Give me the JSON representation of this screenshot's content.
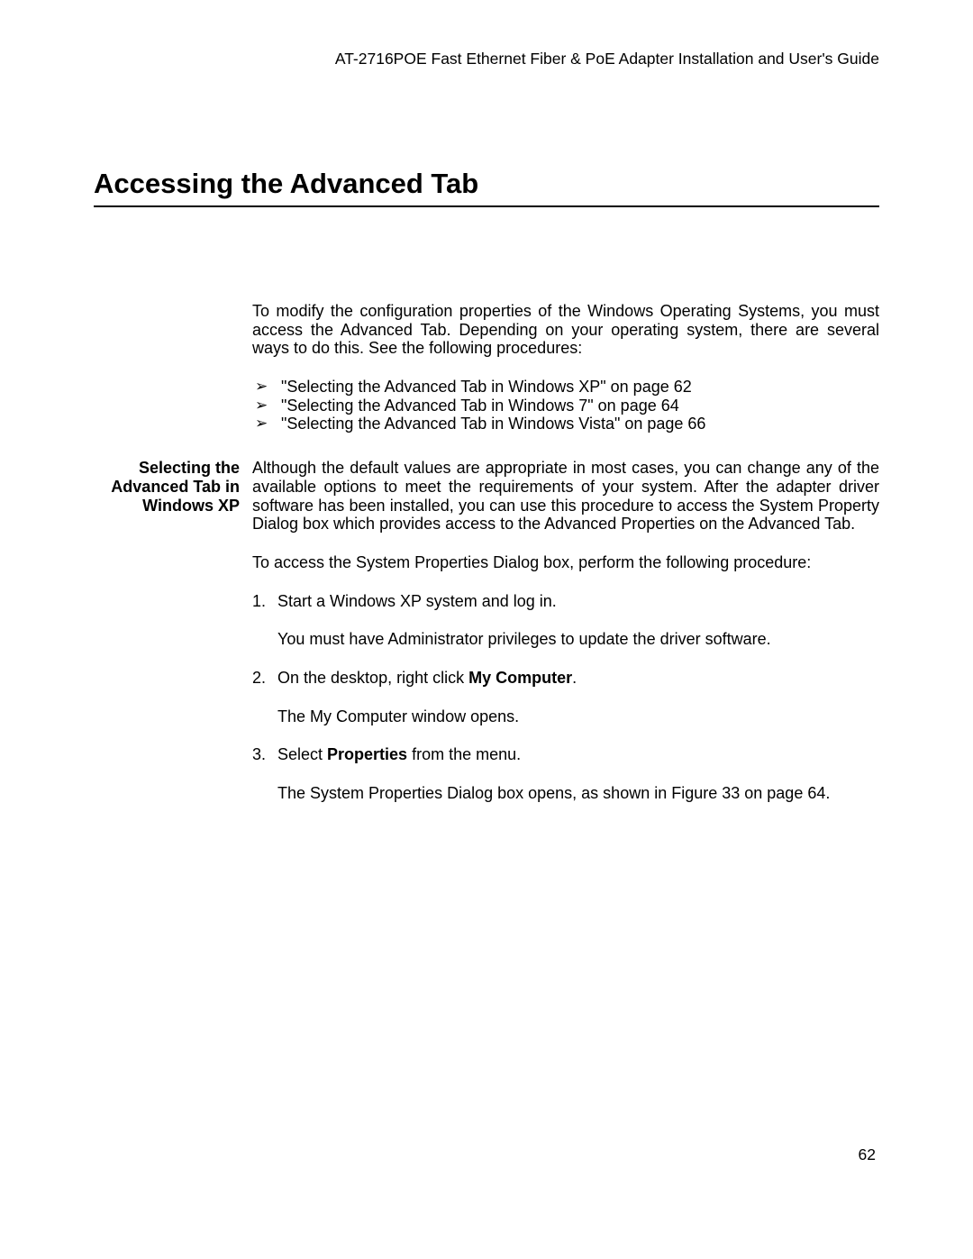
{
  "header": "AT-2716POE Fast Ethernet Fiber & PoE Adapter Installation and User's Guide",
  "title": "Accessing the Advanced Tab",
  "intro": "To modify the configuration properties of the Windows Operating Systems, you must access the Advanced Tab. Depending on your operating system, there are several ways to do this. See the following procedures:",
  "bullets": [
    "\"Selecting the Advanced Tab in Windows XP\" on page 62",
    "\"Selecting the Advanced Tab in Windows 7\" on page 64",
    "\"Selecting the Advanced Tab in Windows Vista\" on page 66"
  ],
  "section_label": "Selecting the Advanced Tab in Windows XP",
  "para1": "Although the default values are appropriate in most cases, you can change any of the available options to meet the requirements of your system. After the adapter driver software has been installed, you can use this procedure to access the System Property Dialog box which provides access to the Advanced Properties on the Advanced Tab.",
  "para2": "To access the System Properties Dialog box, perform the following procedure:",
  "steps": {
    "s1_num": "1.",
    "s1_text": "Start a Windows XP system and log in.",
    "s1_sub": "You must have Administrator privileges to update the driver software.",
    "s2_num": "2.",
    "s2_text_a": "On the desktop, right click ",
    "s2_bold": "My Computer",
    "s2_text_b": ".",
    "s2_sub": "The My Computer window opens.",
    "s3_num": "3.",
    "s3_text_a": "Select ",
    "s3_bold": "Properties",
    "s3_text_b": " from the menu.",
    "s3_sub": "The System Properties Dialog box opens, as shown in Figure 33 on page 64."
  },
  "page_number": "62"
}
